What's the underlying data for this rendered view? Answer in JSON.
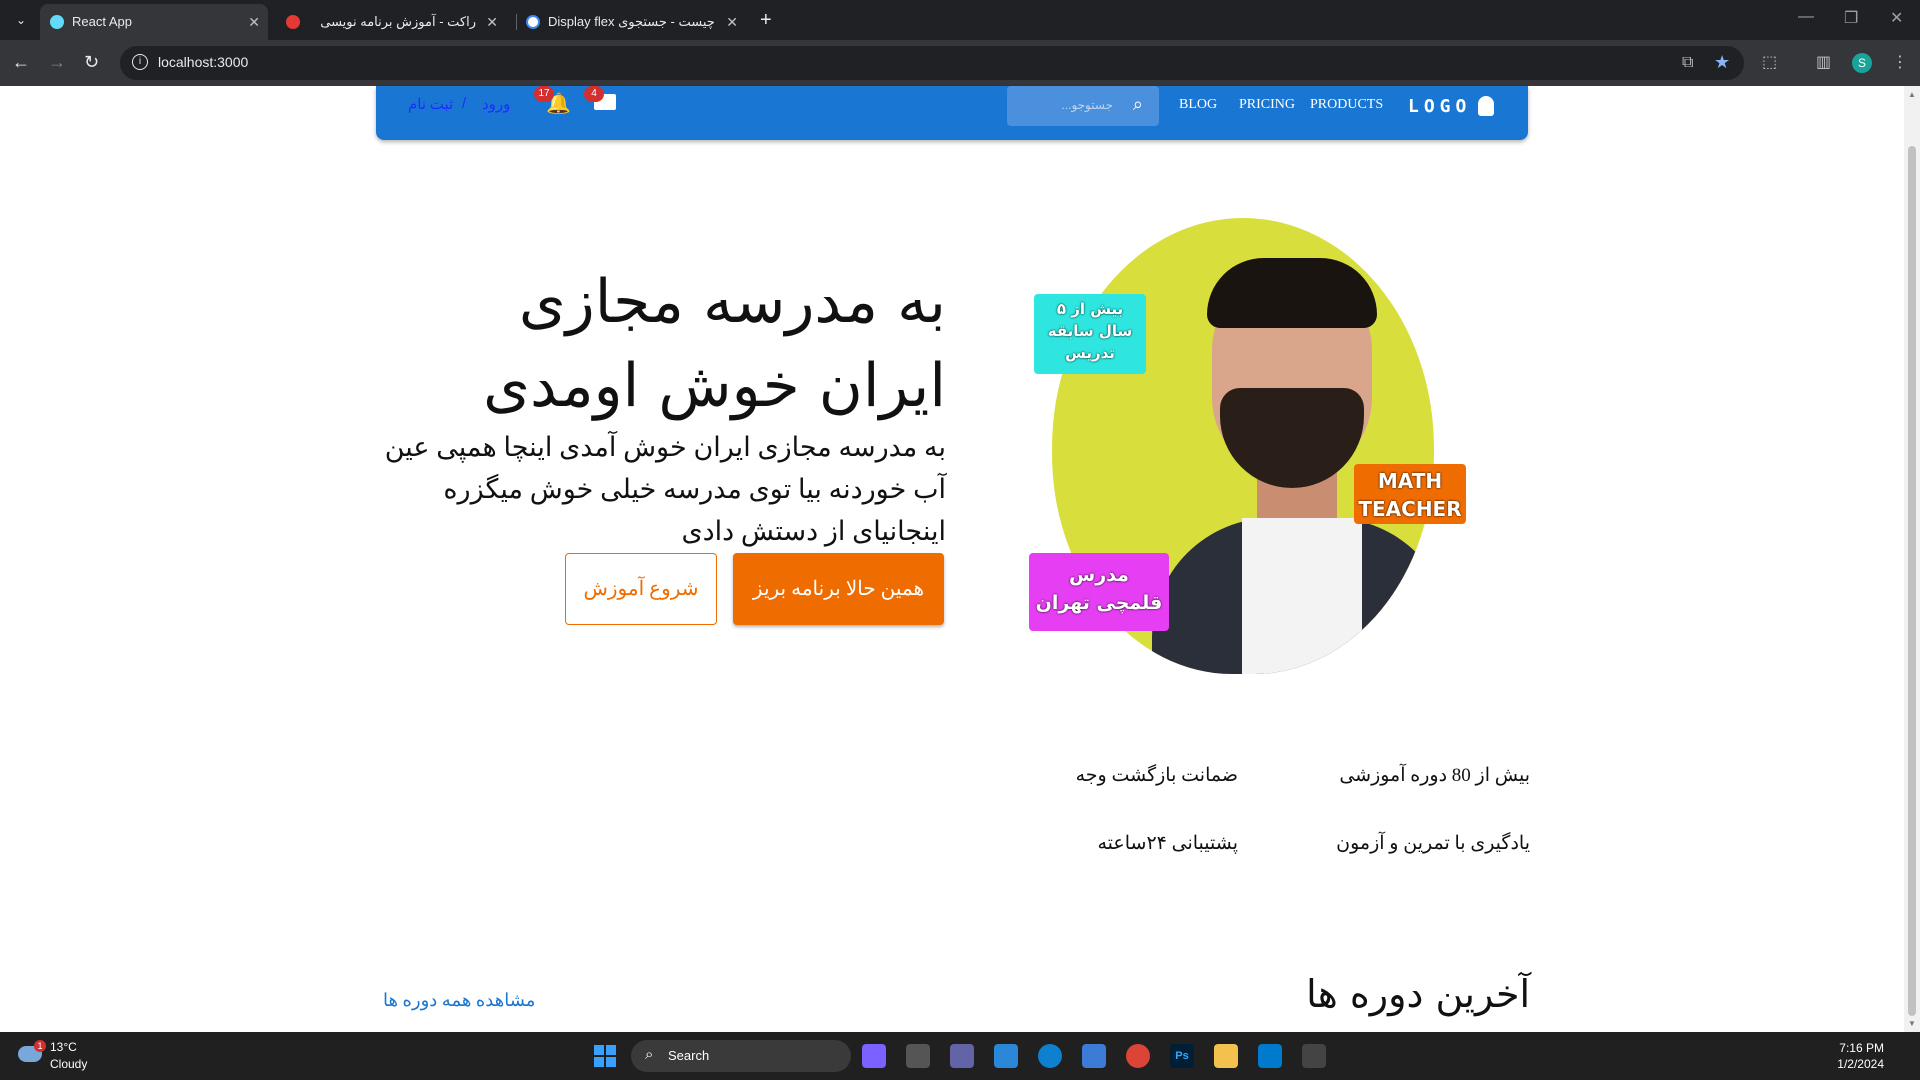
{
  "browser": {
    "tabs": [
      {
        "title": "React App",
        "active": true
      },
      {
        "title": "راکت - آموزش برنامه نویسی",
        "active": false
      },
      {
        "title": "Display flex چیست - جستجوی Go",
        "active": false
      }
    ],
    "address": "localhost:3000",
    "profile_initial": "S"
  },
  "header": {
    "logo": "LOGO",
    "nav": [
      "PRODUCTS",
      "PRICING",
      "BLOG"
    ],
    "search_placeholder": "جستوجو...",
    "mail_count": "4",
    "notification_count": "17",
    "login": "ورود",
    "separator": "/",
    "signup": "ثبت نام",
    "bar_color": "#1976d2"
  },
  "hero": {
    "title": "به مدرسه مجازی ایران خوش اومدی",
    "subtitle": "به مدرسه مجازی ایران خوش آمدی اینچا همپی عین آب خوردنه بیا توی مدرسه خیلی خوش میگزره اینجانیای از دستش دادی",
    "primary_button": "همین حالا برنامه بریز",
    "secondary_button": "شروع آموزش",
    "accent_color": "#ef6c00",
    "tags": {
      "experience": [
        "بیش از ۵",
        "سال سابقه",
        "تدریس"
      ],
      "math": [
        "MATH",
        "TEACHER"
      ],
      "teacher": [
        "مدرس",
        "قلمچی تهران"
      ]
    }
  },
  "features": [
    "بیش از 80 دوره آموزشی",
    "ضمانت بازگشت وجه",
    "یادگیری با تمرین و آزمون",
    "پشتیبانی ۲۴ساعته"
  ],
  "latest": {
    "title": "آخرین دوره ها",
    "see_all": "مشاهده همه دوره ها"
  },
  "taskbar": {
    "temperature": "13°C",
    "condition": "Cloudy",
    "weather_badge": "1",
    "search_label": "Search",
    "time": "7:16 PM",
    "date": "1/2/2024"
  }
}
